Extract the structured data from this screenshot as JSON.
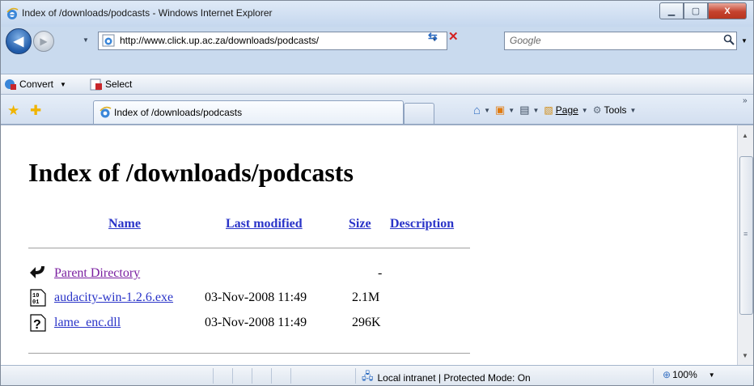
{
  "window": {
    "title": "Index of /downloads/podcasts - Windows Internet Explorer"
  },
  "nav": {
    "url": "http://www.click.up.ac.za/downloads/podcasts/",
    "search_placeholder": "Google"
  },
  "toolbar": {
    "convert_label": "Convert",
    "select_label": "Select"
  },
  "tab": {
    "label": "Index of /downloads/podcasts"
  },
  "commandbar": {
    "page_label": "Page",
    "tools_label": "Tools"
  },
  "page": {
    "heading": "Index of /downloads/podcasts",
    "columns": {
      "name": "Name",
      "modified": "Last modified",
      "size": "Size",
      "description": "Description"
    },
    "rows": [
      {
        "name": "Parent Directory",
        "modified": "",
        "size": "-",
        "icon": "back-arrow-icon"
      },
      {
        "name": "audacity-win-1.2.6.exe",
        "modified": "03-Nov-2008 11:49",
        "size": "2.1M",
        "icon": "binary-file-icon"
      },
      {
        "name": "lame_enc.dll",
        "modified": "03-Nov-2008 11:49",
        "size": "296K",
        "icon": "unknown-file-icon"
      }
    ]
  },
  "statusbar": {
    "zone": "Local intranet | Protected Mode: On",
    "zoom": "100%"
  },
  "colors": {
    "link": "#2a34c8",
    "visited": "#7a1fa0",
    "accent": "#1f5aa8"
  }
}
